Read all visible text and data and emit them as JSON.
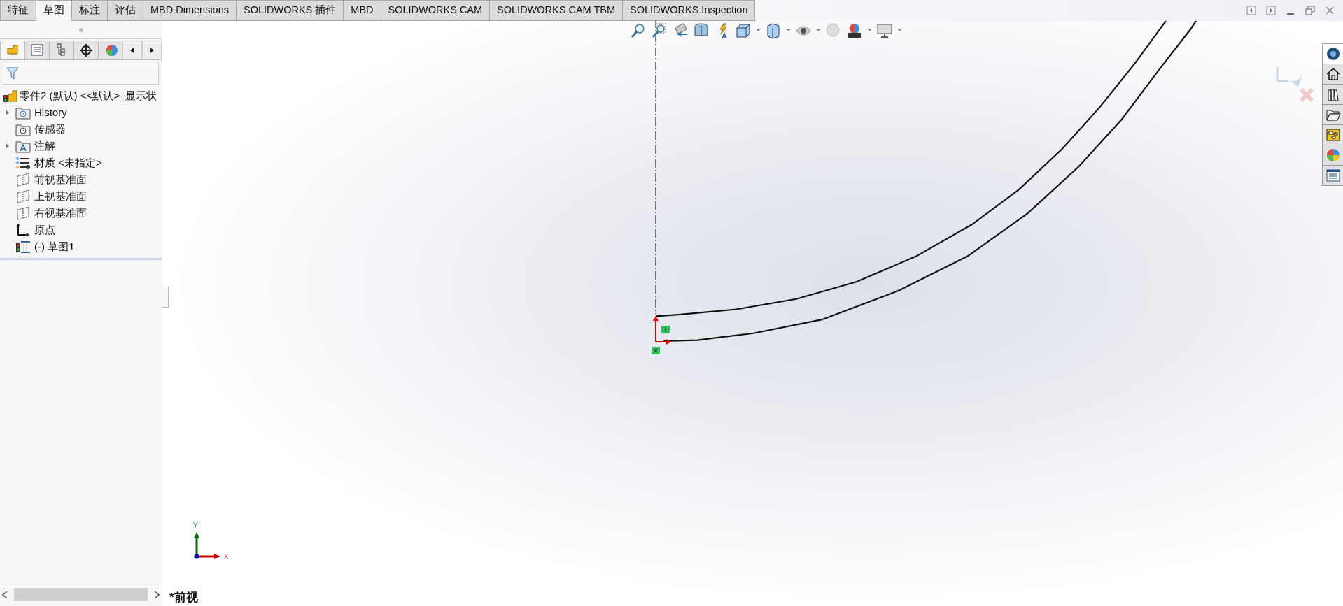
{
  "tabs": [
    {
      "label": "特征",
      "selected": false
    },
    {
      "label": "草图",
      "selected": true
    },
    {
      "label": "标注",
      "selected": false
    },
    {
      "label": "评估",
      "selected": false
    },
    {
      "label": "MBD Dimensions",
      "selected": false
    },
    {
      "label": "SOLIDWORKS 插件",
      "selected": false
    },
    {
      "label": "MBD",
      "selected": false
    },
    {
      "label": "SOLIDWORKS CAM",
      "selected": false
    },
    {
      "label": "SOLIDWORKS CAM TBM",
      "selected": false
    },
    {
      "label": "SOLIDWORKS Inspection",
      "selected": false
    }
  ],
  "panel_tabs": [
    {
      "kind": "feature",
      "selected": true
    },
    {
      "kind": "property",
      "selected": false
    },
    {
      "kind": "config",
      "selected": false
    },
    {
      "kind": "dimxpert",
      "selected": false
    },
    {
      "kind": "display",
      "selected": false
    }
  ],
  "tree": {
    "root": "零件2 (默认) <<默认>_显示状",
    "items": [
      {
        "kind": "history",
        "label": "History",
        "collapsible": true
      },
      {
        "kind": "sensor",
        "label": "传感器",
        "collapsible": false
      },
      {
        "kind": "annotation",
        "label": "注解",
        "collapsible": true
      },
      {
        "kind": "material",
        "label": "材质 <未指定>",
        "collapsible": false
      },
      {
        "kind": "plane",
        "label": "前视基准面",
        "collapsible": false
      },
      {
        "kind": "plane",
        "label": "上视基准面",
        "collapsible": false
      },
      {
        "kind": "plane",
        "label": "右视基准面",
        "collapsible": false
      },
      {
        "kind": "origin",
        "label": "原点",
        "collapsible": false
      },
      {
        "kind": "sketch",
        "label": "(-) 草图1",
        "collapsible": false
      }
    ]
  },
  "task_pane": [
    {
      "kind": "resources",
      "selected": true
    },
    {
      "kind": "home",
      "selected": false
    },
    {
      "kind": "library",
      "selected": false
    },
    {
      "kind": "folder",
      "selected": false
    },
    {
      "kind": "palette",
      "selected": false
    },
    {
      "kind": "appearance",
      "selected": false
    },
    {
      "kind": "properties",
      "selected": false
    }
  ],
  "viewport": {
    "triad_y": "Y",
    "triad_x": "X",
    "view_name": "*前视"
  }
}
